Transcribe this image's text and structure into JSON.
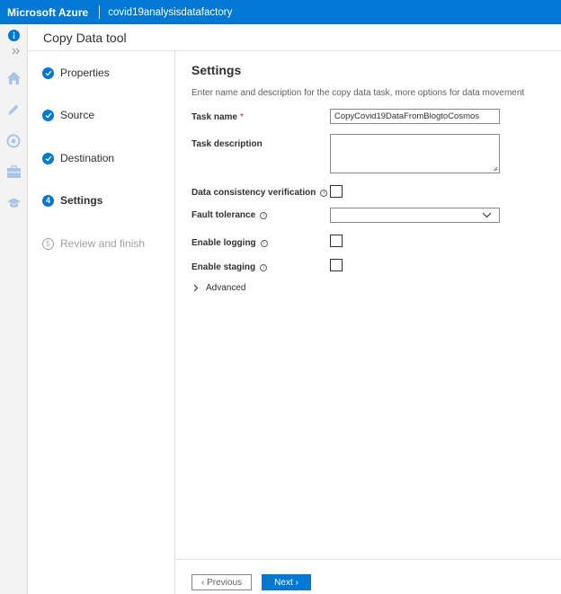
{
  "topbar": {
    "brand": "Microsoft Azure",
    "factory": "covid19analysisdatafactory"
  },
  "header": {
    "title": "Copy Data tool"
  },
  "steps": [
    {
      "label": "Properties",
      "state": "done"
    },
    {
      "label": "Source",
      "state": "done"
    },
    {
      "label": "Destination",
      "state": "done"
    },
    {
      "label": "Settings",
      "state": "current",
      "number": "4"
    },
    {
      "label": "Review and finish",
      "state": "pending",
      "number": "5"
    }
  ],
  "settings": {
    "title": "Settings",
    "description": "Enter name and description for the copy data task, more options for data movement",
    "task_name_label": "Task name",
    "required_mark": "*",
    "task_name_value": "CopyCovid19DataFromBlogtoCosmos",
    "task_description_label": "Task description",
    "task_description_value": "",
    "data_consistency_label": "Data consistency verification",
    "data_consistency_checked": false,
    "fault_tolerance_label": "Fault tolerance",
    "fault_tolerance_value": "",
    "enable_logging_label": "Enable logging",
    "enable_logging_checked": false,
    "enable_staging_label": "Enable staging",
    "enable_staging_checked": false,
    "advanced_label": "Advanced"
  },
  "footer": {
    "previous_label": "Previous",
    "next_label": "Next"
  },
  "colors": {
    "accent": "#0078d4",
    "required": "#a4262c"
  },
  "icons": {
    "rail": [
      "info-icon",
      "collapse-icon",
      "home-icon",
      "pencil-icon",
      "monitor-icon",
      "toolbox-icon",
      "learn-icon"
    ]
  }
}
